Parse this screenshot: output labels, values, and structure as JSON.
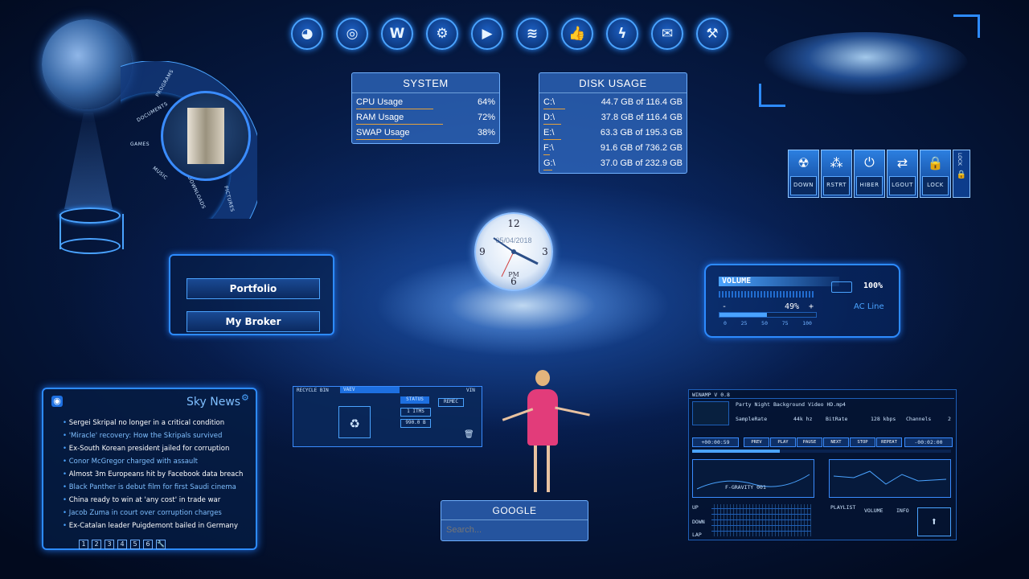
{
  "top_icons": [
    {
      "name": "reddit-icon",
      "glyph": "◕"
    },
    {
      "name": "chrome-icon",
      "glyph": "◎"
    },
    {
      "name": "word-icon",
      "glyph": "W"
    },
    {
      "name": "steam-icon",
      "glyph": "⚙"
    },
    {
      "name": "youtube-icon",
      "glyph": "▶"
    },
    {
      "name": "spotify-icon",
      "glyph": "≋"
    },
    {
      "name": "facebook-like-icon",
      "glyph": "👍"
    },
    {
      "name": "winamp-icon",
      "glyph": "ϟ"
    },
    {
      "name": "mail-icon",
      "glyph": "✉"
    },
    {
      "name": "hammer-icon",
      "glyph": "⚒"
    }
  ],
  "system": {
    "title": "SYSTEM",
    "rows": [
      {
        "label": "CPU Usage",
        "value": "64%",
        "fraction": 0.64
      },
      {
        "label": "RAM Usage",
        "value": "72%",
        "fraction": 0.72
      },
      {
        "label": "SWAP Usage",
        "value": "38%",
        "fraction": 0.38
      }
    ]
  },
  "disk": {
    "title": "DISK USAGE",
    "rows": [
      {
        "drive": "C:\\",
        "value": "44.7 GB of 116.4 GB",
        "fraction": 0.38
      },
      {
        "drive": "D:\\",
        "value": "37.8 GB of 116.4 GB",
        "fraction": 0.32
      },
      {
        "drive": "E:\\",
        "value": "63.3 GB of 195.3 GB",
        "fraction": 0.32
      },
      {
        "drive": "F:\\",
        "value": "91.6 GB of 736.2 GB",
        "fraction": 0.12
      },
      {
        "drive": "G:\\",
        "value": "37.0 GB of 232.9 GB",
        "fraction": 0.16
      }
    ]
  },
  "clock": {
    "date": "05/04/2018",
    "ampm": "PM",
    "n12": "12",
    "n3": "3",
    "n6": "6",
    "n9": "9"
  },
  "portfolio": {
    "btn1": "Portfolio",
    "btn2": "My Broker"
  },
  "arc_menu": [
    "PROGRAMS",
    "DOCUMENTS",
    "GAMES",
    "MUSIC",
    "DOWNLOADS",
    "PICTURES"
  ],
  "power": [
    {
      "glyph": "☢",
      "label": "DOWN"
    },
    {
      "glyph": "⁂",
      "label": "RSTRT"
    },
    {
      "glyph": "⏻",
      "label": "HIBER"
    },
    {
      "glyph": "⇄",
      "label": "LGOUT"
    },
    {
      "glyph": "🔒",
      "label": "LOCK"
    }
  ],
  "power_side": {
    "label": "LOCK",
    "glyph": "🔒"
  },
  "volume": {
    "title": "VOLUME",
    "level": "49%",
    "level_fraction": 0.49,
    "minus": "-",
    "plus": "+",
    "battery": "100%",
    "source": "AC Line",
    "ticks": [
      "0",
      "25",
      "50",
      "75",
      "100"
    ]
  },
  "news": {
    "title": "Sky News",
    "items": [
      "Sergei Skripal no longer in a critical condition",
      "'Miracle' recovery: How the Skripals survived",
      "Ex-South Korean president jailed for corruption",
      "Conor McGregor charged with assault",
      "Almost 3m Europeans hit by Facebook data breach",
      "Black Panther is debut film for first Saudi cinema",
      "China ready to win at 'any cost' in trade war",
      "Jacob Zuma in court over corruption charges",
      "Ex-Catalan leader Puigdemont bailed in Germany"
    ],
    "pages": [
      "1",
      "2",
      "3",
      "4",
      "5",
      "6"
    ]
  },
  "recycle": {
    "title": "RECYCLE BIN",
    "tab": "VAEV",
    "tab2": "VIN",
    "status": "STATUS",
    "items": "1 ITMS",
    "size": "990.0 B",
    "empty": "REMEC"
  },
  "google": {
    "title": "GOOGLE",
    "placeholder": "Search..."
  },
  "winamp": {
    "title": "WINAMP V 0.8",
    "track": "Party Night Background Video HD.mp4",
    "sr_label": "SampleRate",
    "sr": "44k hz",
    "br_label": "BitRate",
    "br": "128 kbps",
    "ch_label": "Channels",
    "ch": "2",
    "elapsed": "+00:00:59",
    "remaining": "-00:02:00",
    "buttons": [
      "PREV",
      "PLAY",
      "PAUSE",
      "NEXT",
      "STOP",
      "REPEAT"
    ],
    "eq_label": "F-GRAVITY 001",
    "up": "UP",
    "down": "DOWN",
    "lap": "LAP",
    "playlist": "PLAYLIST",
    "vol": "VOLUME",
    "info": "INFO"
  }
}
